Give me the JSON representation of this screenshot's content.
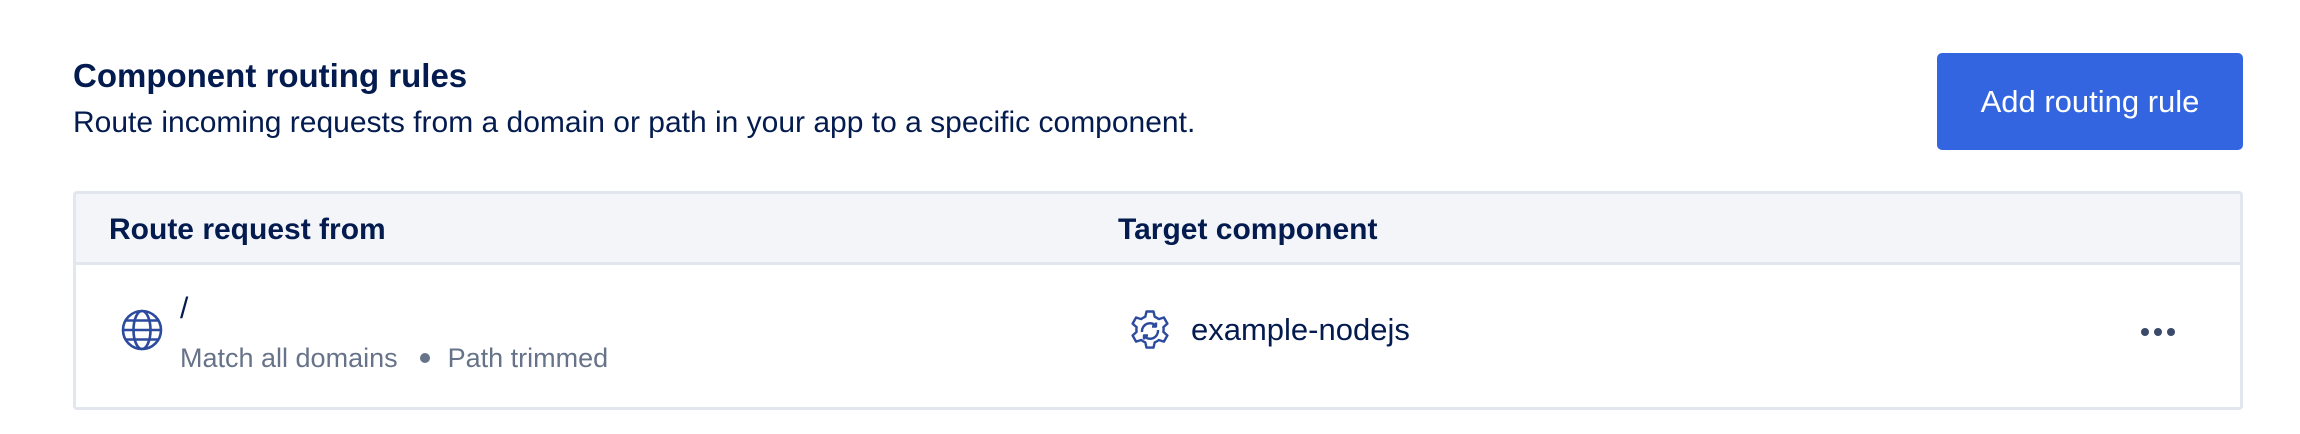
{
  "header": {
    "title": "Component routing rules",
    "description": "Route incoming requests from a domain or path in your app to a specific component.",
    "add_button_label": "Add routing rule"
  },
  "table": {
    "columns": [
      "Route request from",
      "Target component"
    ],
    "rows": [
      {
        "route_icon": "globe-icon",
        "path": "/",
        "domain_match": "Match all domains",
        "path_option": "Path trimmed",
        "component_icon": "gear-icon",
        "component": "example-nodejs",
        "actions_icon": "more-options-icon"
      }
    ]
  },
  "colors": {
    "text": "#031b4e",
    "muted_text": "#677389",
    "accent": "#3465e1",
    "header_bg": "#f3f5f9",
    "border": "#e2e6ee",
    "icon": "#2c4a9e"
  }
}
